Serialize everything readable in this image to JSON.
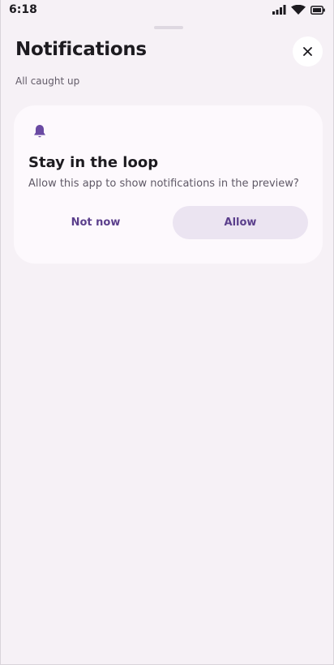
{
  "status_bar": {
    "time": "6:18",
    "icons": [
      "signal-icon",
      "wifi-icon",
      "battery-icon"
    ]
  },
  "sheet": {
    "title": "Notifications",
    "subtitle": "All caught up",
    "close_icon": "close-icon"
  },
  "card": {
    "icon": "bell-icon",
    "title": "Stay in the loop",
    "body": "Allow this app to show notifications in the preview?",
    "secondary_label": "Not now",
    "primary_label": "Allow"
  },
  "colors": {
    "background": "#f6f1f6",
    "card": "#fdf9fd",
    "accent": "#5b3f8c",
    "primary_button_bg": "#ebe4f1"
  }
}
